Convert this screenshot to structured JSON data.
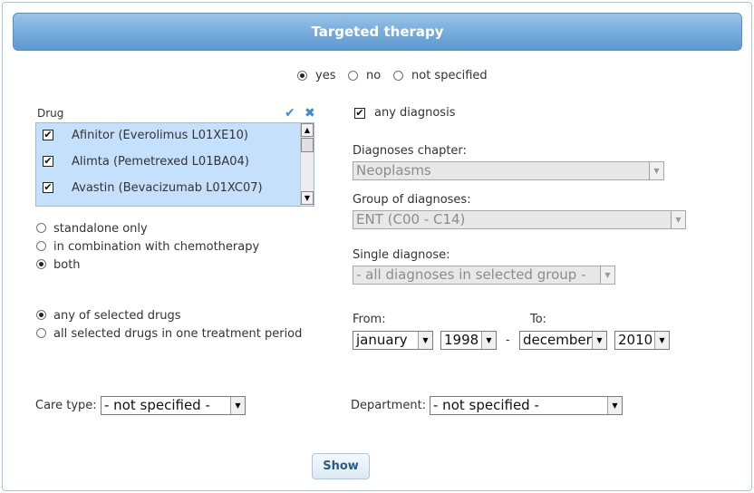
{
  "title": "Targeted therapy",
  "therapy_filter": {
    "options": [
      "yes",
      "no",
      "not specified"
    ],
    "selected": "yes"
  },
  "drug": {
    "label": "Drug",
    "items": [
      {
        "label": "Afinitor (Everolimus L01XE10)",
        "checked": true
      },
      {
        "label": "Alimta (Pemetrexed L01BA04)",
        "checked": true
      },
      {
        "label": "Avastin (Bevacizumab L01XC07)",
        "checked": true
      }
    ],
    "check_all_icon": "check-icon",
    "clear_icon": "close-icon"
  },
  "combination": {
    "options": [
      "standalone only",
      "in combination with chemotherapy",
      "both"
    ],
    "selected": "both"
  },
  "drug_match": {
    "options": [
      "any of selected drugs",
      "all selected drugs in one treatment period"
    ],
    "selected": "any of selected drugs"
  },
  "any_diagnosis": {
    "label": "any diagnosis",
    "checked": true
  },
  "diagnoses_chapter": {
    "label": "Diagnoses chapter:",
    "value": "Neoplasms"
  },
  "group_of_diagnoses": {
    "label": "Group of diagnoses:",
    "value": "ENT (C00 - C14)"
  },
  "single_diagnose": {
    "label": "Single diagnose:",
    "value": "- all diagnoses in selected group -"
  },
  "period": {
    "from_label": "From:",
    "to_label": "To:",
    "from_month": "january",
    "from_year": "1998",
    "separator": "-",
    "to_month": "december",
    "to_year": "2010"
  },
  "care_type": {
    "label": "Care type:",
    "value": "- not specified -"
  },
  "department": {
    "label": "Department:",
    "value": "- not specified -"
  },
  "show_button": "Show",
  "colors": {
    "title_bar": "#7aafdd",
    "list_bg": "#c5e0fb",
    "accent": "#3a8bd1"
  }
}
